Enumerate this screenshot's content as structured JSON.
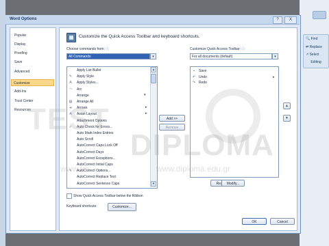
{
  "window_title": "Word Options",
  "help_button": "?",
  "close_button": "X",
  "nav_items": [
    "Popular",
    "Display",
    "Proofing",
    "Save",
    "Advanced",
    "Customize",
    "Add-Ins",
    "Trust Center",
    "Resources"
  ],
  "nav_active": "Customize",
  "header_text": "Customize the Quick Access Toolbar and keyboard shortcuts.",
  "choose_label": "Choose commands from:",
  "choose_value": "All Commands",
  "customize_label": "Customize Quick Access Toolbar:",
  "customize_value": "For all documents (default)",
  "commands": [
    {
      "label": "Apply List Bullet",
      "icon": "",
      "arrow": ""
    },
    {
      "label": "Apply Style",
      "icon": "✎",
      "arrow": ""
    },
    {
      "label": "Apply Styles...",
      "icon": "A",
      "arrow": ""
    },
    {
      "label": "Arc",
      "icon": "◠",
      "arrow": ""
    },
    {
      "label": "Arrange",
      "icon": "",
      "arrow": "▾"
    },
    {
      "label": "Arrange All",
      "icon": "▤",
      "arrow": ""
    },
    {
      "label": "Arrows",
      "icon": "➜",
      "arrow": "▸"
    },
    {
      "label": "Asian Layout",
      "icon": "A",
      "arrow": "▸"
    },
    {
      "label": "Attachment Options",
      "icon": "",
      "arrow": ""
    },
    {
      "label": "Auto Check for Errors...",
      "icon": "✓",
      "arrow": ""
    },
    {
      "label": "Auto Mark Index Entries",
      "icon": "",
      "arrow": ""
    },
    {
      "label": "Auto Scroll",
      "icon": "",
      "arrow": ""
    },
    {
      "label": "AutoCorrect Caps Lock Off",
      "icon": "",
      "arrow": ""
    },
    {
      "label": "AutoCorrect Days",
      "icon": "",
      "arrow": ""
    },
    {
      "label": "AutoCorrect Exceptions...",
      "icon": "",
      "arrow": ""
    },
    {
      "label": "AutoCorrect Initial Caps",
      "icon": "",
      "arrow": ""
    },
    {
      "label": "AutoCorrect Options...",
      "icon": "✎",
      "arrow": ""
    },
    {
      "label": "AutoCorrect Replace Text",
      "icon": "",
      "arrow": ""
    },
    {
      "label": "AutoCorrect Sentence Caps",
      "icon": "",
      "arrow": ""
    }
  ],
  "toolbar_items": [
    {
      "label": "Save",
      "icon": "▪"
    },
    {
      "label": "Undo",
      "icon": "↶"
    },
    {
      "label": "Redo",
      "icon": "↷"
    }
  ],
  "add_button": "Add >>",
  "remove_button": "Remove",
  "reset_button": "Reset",
  "modify_button": "Modify...",
  "show_qat_label": "Show Quick Access Toolbar below the Ribbon",
  "keyboard_label": "Keyboard shortcuts:",
  "customize_button": "Customize...",
  "ok_button": "OK",
  "cancel_button": "Cancel",
  "ribbon": {
    "find": "Find",
    "replace": "Replace",
    "select": "Select",
    "group": "Editing"
  },
  "watermark": {
    "logo": "TEST",
    "brand": "DIPLOMA",
    "url": "www.diploma.edu.gr",
    "url2": "www.tes"
  }
}
